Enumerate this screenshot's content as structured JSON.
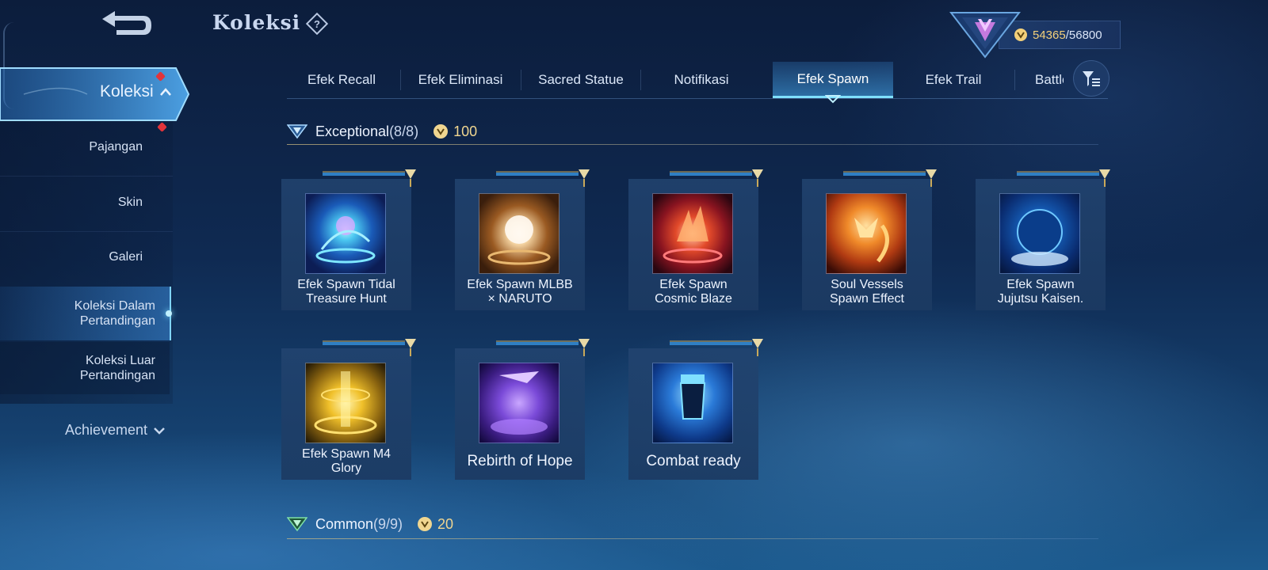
{
  "header": {
    "title": "Koleksi",
    "currency": {
      "current": "54365",
      "separator": "/",
      "max": "56800"
    }
  },
  "sidebar": {
    "active_label": "Koleksi",
    "items": [
      {
        "label": "Pajangan"
      },
      {
        "label": "Skin"
      },
      {
        "label": "Galeri"
      },
      {
        "label": "Koleksi Dalam\nPertandingan",
        "selected": true
      },
      {
        "label": "Koleksi Luar\nPertandingan"
      }
    ],
    "achievement_label": "Achievement"
  },
  "tabs": [
    {
      "label": "Efek Recall"
    },
    {
      "label": "Efek Eliminasi"
    },
    {
      "label": "Sacred Statue"
    },
    {
      "label": "Notifikasi"
    },
    {
      "label": "Efek Spawn",
      "active": true
    },
    {
      "label": "Efek Trail"
    },
    {
      "label": "Battle I"
    }
  ],
  "sections": {
    "exceptional": {
      "name": "Exceptional",
      "count": "(8/8)",
      "cost": "100"
    },
    "common": {
      "name": "Common",
      "count": "(9/9)",
      "cost": "20"
    }
  },
  "items": [
    {
      "label": "Efek Spawn Tidal\nTreasure Hunt",
      "art": "tidal-treasure"
    },
    {
      "label": "Efek Spawn MLBB\n× NARUTO",
      "art": "naruto"
    },
    {
      "label": "Efek Spawn\nCosmic Blaze",
      "art": "cosmic-blaze"
    },
    {
      "label": "Soul Vessels\nSpawn Effect",
      "art": "soul-vessels"
    },
    {
      "label": "Efek Spawn\nJujutsu Kaisen.",
      "art": "jujutsu"
    },
    {
      "label": "Efek Spawn M4\nGlory",
      "art": "m4-glory"
    },
    {
      "label": "Rebirth of Hope",
      "art": "rebirth"
    },
    {
      "label": "Combat ready",
      "art": "combat-ready"
    }
  ],
  "colors": {
    "accent": "#7fe0ff",
    "gold": "#f0d690",
    "badge": "#e2343a"
  }
}
